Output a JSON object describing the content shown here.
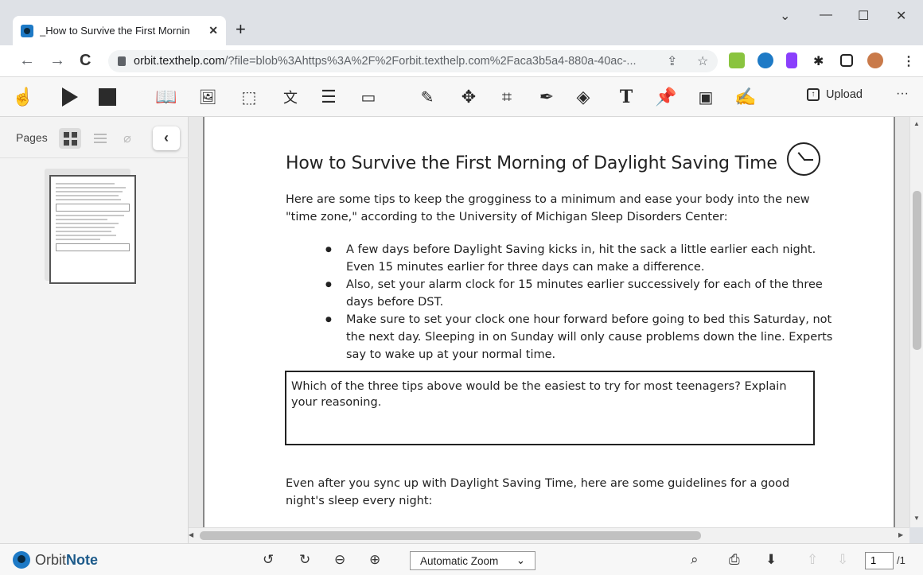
{
  "browser": {
    "tab_title": "_How to Survive the First Mornin",
    "tab_close": "✕",
    "new_tab": "+",
    "win_min": "—",
    "win_max": "☐",
    "win_close": "✕",
    "win_chevron": "⌄",
    "url_host": "orbit.texthelp.com",
    "url_path": "/?file=blob%3Ahttps%3A%2F%2Forbit.texthelp.com%2Faca3b5a4-880a-40ac-..."
  },
  "toolbar": {
    "upload_label": "Upload",
    "more_label": "···"
  },
  "sidebar": {
    "label": "Pages",
    "collapse": "‹"
  },
  "document": {
    "title": "How to Survive the First Morning of Daylight Saving Time",
    "intro_line1": "Here are some tips to keep the grogginess to a minimum and ease your body into the new",
    "intro_line2": "\"time zone,\" according to the University of Michigan Sleep Disorders Center:",
    "bullets": [
      "A few days before Daylight Saving kicks in, hit the sack a little earlier each night. Even 15 minutes earlier for three days can make a difference.",
      "Also, set your alarm clock for 15 minutes earlier successively for each of the three days before DST.",
      "Make sure to set your clock one hour forward before going to bed this Saturday, not the next day. Sleeping in on Sunday will only cause problems down the line. Experts say to wake up at your normal time."
    ],
    "question": "Which of the three tips above would be the easiest to try for most teenagers?  Explain your reasoning.",
    "after_line1": "Even after you sync up with Daylight Saving Time, here are some guidelines for a good",
    "after_line2": "night's sleep every night:"
  },
  "bottom": {
    "logo_orbit": "Orbit",
    "logo_note": "Note",
    "zoom_value": "Automatic Zoom",
    "page_current": "1",
    "page_total": "/1"
  }
}
